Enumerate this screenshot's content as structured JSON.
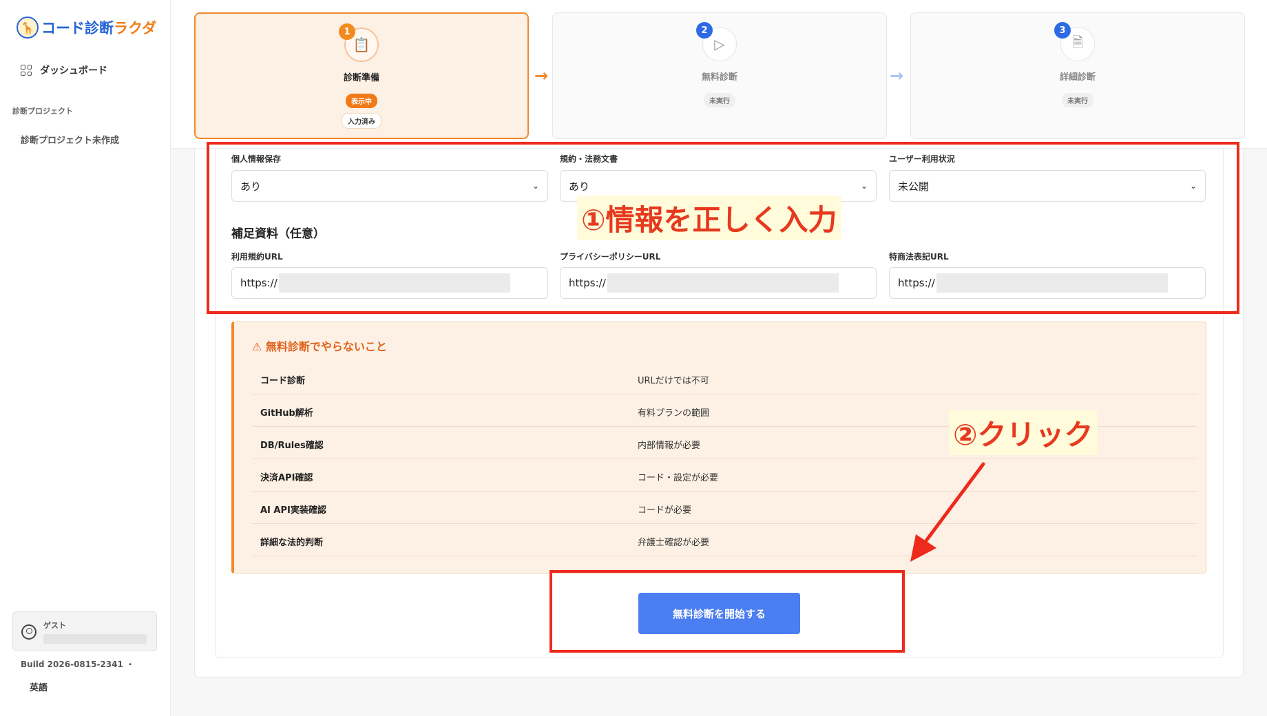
{
  "app": {
    "logo_mark": "🦒",
    "logo_part1": "コード診断",
    "logo_part2": "ラクダ"
  },
  "sidebar": {
    "dashboard": "ダッシュボード",
    "section": "診断プロジェクト",
    "project": "診断プロジェクト未作成",
    "guest_label": "ゲスト",
    "build": "Build 2026-0815-2341 ・",
    "language": "英語"
  },
  "steps": [
    {
      "num": "1",
      "title": "診断準備",
      "status": "表示中",
      "done": "入力済み",
      "icon": "clipboard-check-icon"
    },
    {
      "num": "2",
      "title": "無料診断",
      "status": "未実行",
      "icon": "play-circle-icon"
    },
    {
      "num": "3",
      "title": "詳細診断",
      "status": "未実行",
      "icon": "file-search-icon"
    }
  ],
  "form": {
    "fields": [
      {
        "label": "個人情報保存",
        "value": "あり"
      },
      {
        "label": "規約・法務文書",
        "value": "あり"
      },
      {
        "label": "ユーザー利用状況",
        "value": "未公開"
      }
    ],
    "supplement_title": "補足資料（任意）",
    "urls": [
      {
        "label": "利用規約URL",
        "value": "https://"
      },
      {
        "label": "プライバシーポリシーURL",
        "value": "https://"
      },
      {
        "label": "特商法表記URL",
        "value": "https://"
      }
    ]
  },
  "warning": {
    "icon": "⚠",
    "title": "無料診断でやらないこと",
    "rows": [
      {
        "item": "コード診断",
        "reason": "URLだけでは不可"
      },
      {
        "item": "GitHub解析",
        "reason": "有料プランの範囲"
      },
      {
        "item": "DB/Rules確認",
        "reason": "内部情報が必要"
      },
      {
        "item": "決済API確認",
        "reason": "コード・設定が必要"
      },
      {
        "item": "AI API実装確認",
        "reason": "コードが必要"
      },
      {
        "item": "詳細な法的判断",
        "reason": "弁護士確認が必要"
      }
    ]
  },
  "start_button": "無料診断を開始する",
  "annotations": {
    "step1": "①情報を正しく入力",
    "step2": "②クリック"
  },
  "colors": {
    "accent_orange": "#f0892c",
    "primary_blue": "#4b7ef0",
    "annotation_red": "#ee2a1c"
  }
}
